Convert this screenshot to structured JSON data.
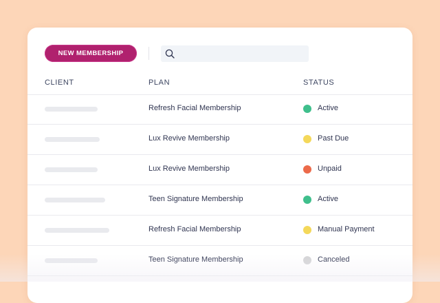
{
  "toolbar": {
    "new_button_label": "NEW MEMBERSHIP",
    "search_placeholder": "",
    "search_value": ""
  },
  "table": {
    "columns": [
      "CLIENT",
      "PLAN",
      "STATUS"
    ],
    "rows": [
      {
        "client": "",
        "plan": "Refresh Facial Membership",
        "status": "Active",
        "status_color": "#3fbf8c"
      },
      {
        "client": "",
        "plan": "Lux Revive Membership",
        "status": "Past Due",
        "status_color": "#f4d85a"
      },
      {
        "client": "",
        "plan": "Lux Revive Membership",
        "status": "Unpaid",
        "status_color": "#ec6a4a"
      },
      {
        "client": "",
        "plan": "Teen Signature Membership",
        "status": "Active",
        "status_color": "#3fbf8c"
      },
      {
        "client": "",
        "plan": "Refresh Facial Membership",
        "status": "Manual Payment",
        "status_color": "#f4d85a"
      },
      {
        "client": "",
        "plan": "Teen Signature Membership",
        "status": "Canceled",
        "status_color": "#d4d4d6"
      }
    ]
  },
  "colors": {
    "background": "#fdd6b8",
    "accent": "#b0216e"
  },
  "icons": {
    "search": "search-icon"
  }
}
